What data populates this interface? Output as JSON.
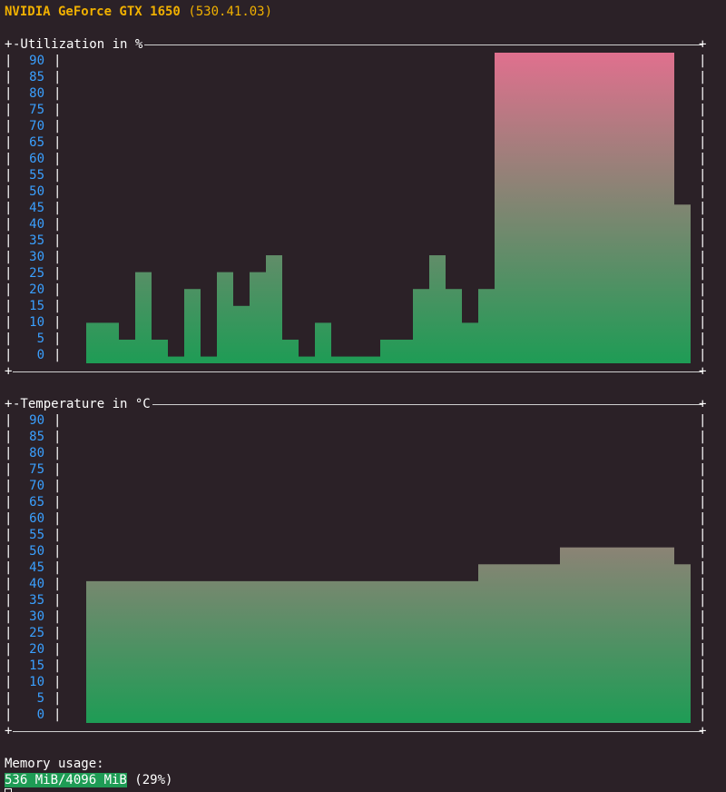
{
  "header": {
    "gpu_name": "NVIDIA GeForce GTX 1650",
    "driver": "(530.41.03)"
  },
  "colors": {
    "bar_low": "#1e9c55",
    "bar_high": "#e0708e",
    "axis_label": "#3aa0ff",
    "title": "#f0b000",
    "background": "#2b2127"
  },
  "utilization_panel": {
    "title": "-Utilization in %",
    "chart_data": {
      "type": "area",
      "ylabel": "Utilization in %",
      "ylim": [
        0,
        90
      ],
      "yticks": [
        90,
        85,
        80,
        75,
        70,
        65,
        60,
        55,
        50,
        45,
        40,
        35,
        30,
        25,
        20,
        15,
        10,
        5,
        0
      ],
      "series": [
        {
          "values": [
            12,
            12,
            7,
            27,
            7,
            2,
            22,
            2,
            27,
            17,
            27,
            32,
            7,
            2,
            12,
            2,
            2,
            2,
            7,
            7,
            22,
            32,
            22,
            12,
            22,
            92,
            92,
            92,
            92,
            92,
            92,
            92,
            92,
            92,
            92,
            92,
            47
          ]
        }
      ]
    }
  },
  "temperature_panel": {
    "title": "-Temperature in °C",
    "chart_data": {
      "type": "area",
      "ylabel": "Temperature in °C",
      "ylim": [
        0,
        90
      ],
      "yticks": [
        90,
        85,
        80,
        75,
        70,
        65,
        60,
        55,
        50,
        45,
        40,
        35,
        30,
        25,
        20,
        15,
        10,
        5,
        0
      ],
      "series": [
        {
          "values": [
            42,
            42,
            42,
            42,
            42,
            42,
            42,
            42,
            42,
            42,
            42,
            42,
            42,
            42,
            42,
            42,
            42,
            42,
            42,
            42,
            42,
            42,
            42,
            42,
            47,
            47,
            47,
            47,
            47,
            52,
            52,
            52,
            52,
            52,
            52,
            52,
            47
          ]
        }
      ]
    }
  },
  "memory": {
    "label": "Memory usage:",
    "used_text": "536 MiB/4096 MiB",
    "percent_text": " (29%)",
    "used_fraction": 0.29
  }
}
